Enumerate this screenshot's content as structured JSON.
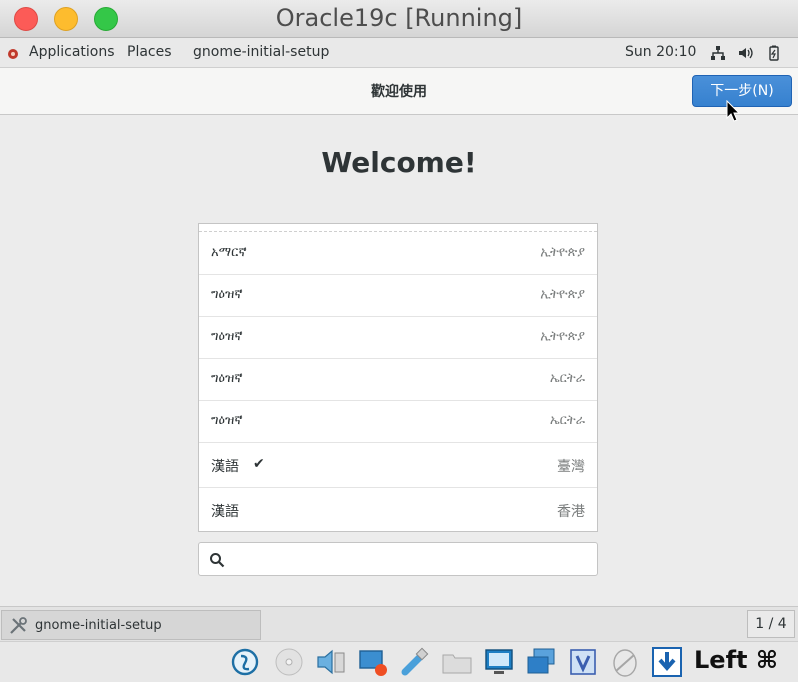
{
  "window": {
    "title": "Oracle19c [Running]"
  },
  "gnome_topbar": {
    "applications": "Applications",
    "places": "Places",
    "app_name": "gnome-initial-setup",
    "clock": "Sun 20:10"
  },
  "setup": {
    "header_title": "歡迎使用",
    "next_button": "下一步(N)",
    "welcome_heading": "Welcome!",
    "languages": [
      {
        "name": "አማርኛ",
        "region": "ኢትዮጵያ",
        "selected": false
      },
      {
        "name": "ግዕዝኛ",
        "region": "ኢትዮጵያ",
        "selected": false
      },
      {
        "name": "ግዕዝኛ",
        "region": "ኢትዮጵያ",
        "selected": false
      },
      {
        "name": "ግዕዝኛ",
        "region": "ኤርትራ",
        "selected": false
      },
      {
        "name": "ግዕዝኛ",
        "region": "ኤርትራ",
        "selected": false
      },
      {
        "name": "漢語",
        "region": "臺灣",
        "selected": true
      },
      {
        "name": "漢語",
        "region": "香港",
        "selected": false
      }
    ],
    "check_mark": "✔",
    "search": {
      "value": "",
      "placeholder": ""
    }
  },
  "taskbar": {
    "task_label": "gnome-initial-setup",
    "workspace": "1 / 4"
  },
  "vbox_status": {
    "host_key": "Left ⌘"
  },
  "colors": {
    "accent": "#3681cf",
    "close": "#fc5b57",
    "minimize": "#fdbc2e",
    "maximize": "#34c748"
  }
}
